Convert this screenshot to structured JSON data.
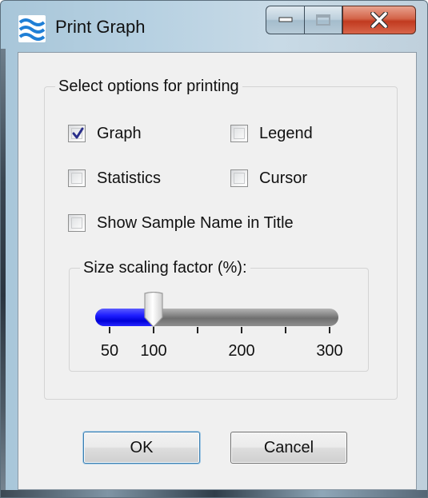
{
  "window": {
    "title": "Print Graph",
    "icon": "wave-icon",
    "caption_buttons": [
      "minimize-icon",
      "maximize-icon",
      "close-icon"
    ],
    "accent_color": "#0000e0"
  },
  "options_group": {
    "label": "Select options for printing",
    "checkboxes": [
      {
        "label": "Graph",
        "checked": true
      },
      {
        "label": "Legend",
        "checked": false
      },
      {
        "label": "Statistics",
        "checked": false
      },
      {
        "label": "Cursor",
        "checked": false
      },
      {
        "label": "Show Sample Name in Title",
        "checked": false
      }
    ]
  },
  "scaling_group": {
    "label": "Size scaling factor (%):",
    "slider": {
      "min": 50,
      "max": 300,
      "value": 100,
      "tick_labels": [
        "50",
        "100",
        "200",
        "300"
      ]
    }
  },
  "buttons": {
    "ok": "OK",
    "cancel": "Cancel"
  }
}
